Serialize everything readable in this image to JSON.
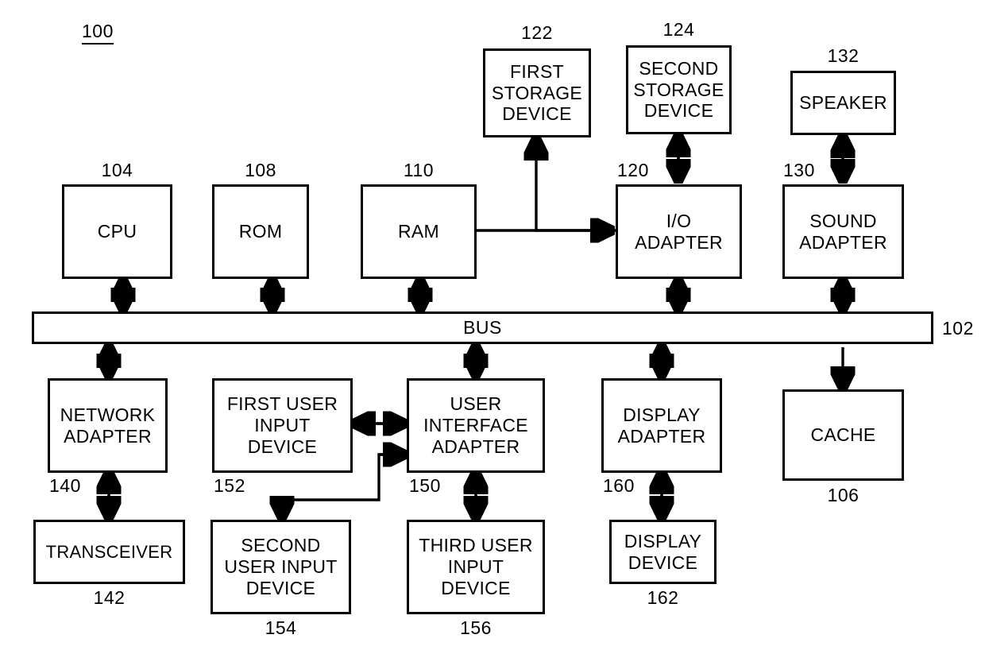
{
  "figure": {
    "number": "100",
    "title_note": "Computer processing system block diagram"
  },
  "bus": {
    "label": "BUS",
    "ref": "102"
  },
  "blocks": {
    "first_storage_device": {
      "label": "FIRST\nSTORAGE\nDEVICE",
      "ref": "122"
    },
    "second_storage_device": {
      "label": "SECOND\nSTORAGE\nDEVICE",
      "ref": "124"
    },
    "speaker": {
      "label": "SPEAKER",
      "ref": "132"
    },
    "cpu": {
      "label": "CPU",
      "ref": "104"
    },
    "rom": {
      "label": "ROM",
      "ref": "108"
    },
    "ram": {
      "label": "RAM",
      "ref": "110"
    },
    "io_adapter": {
      "label": "I/O\nADAPTER",
      "ref": "120"
    },
    "sound_adapter": {
      "label": "SOUND\nADAPTER",
      "ref": "130"
    },
    "network_adapter": {
      "label": "NETWORK\nADAPTER",
      "ref": "140"
    },
    "first_user_input_device": {
      "label": "FIRST USER\nINPUT\nDEVICE",
      "ref": "152"
    },
    "user_interface_adapter": {
      "label": "USER\nINTERFACE\nADAPTER",
      "ref": "150"
    },
    "display_adapter": {
      "label": "DISPLAY\nADAPTER",
      "ref": "160"
    },
    "cache": {
      "label": "CACHE",
      "ref": "106"
    },
    "transceiver": {
      "label": "TRANSCEIVER",
      "ref": "142"
    },
    "second_user_input_device": {
      "label": "SECOND\nUSER INPUT\nDEVICE",
      "ref": "154"
    },
    "third_user_input_device": {
      "label": "THIRD USER\nINPUT\nDEVICE",
      "ref": "156"
    },
    "display_device": {
      "label": "DISPLAY\nDEVICE",
      "ref": "162"
    }
  },
  "colors": {
    "stroke": "#000000",
    "background": "#ffffff"
  }
}
